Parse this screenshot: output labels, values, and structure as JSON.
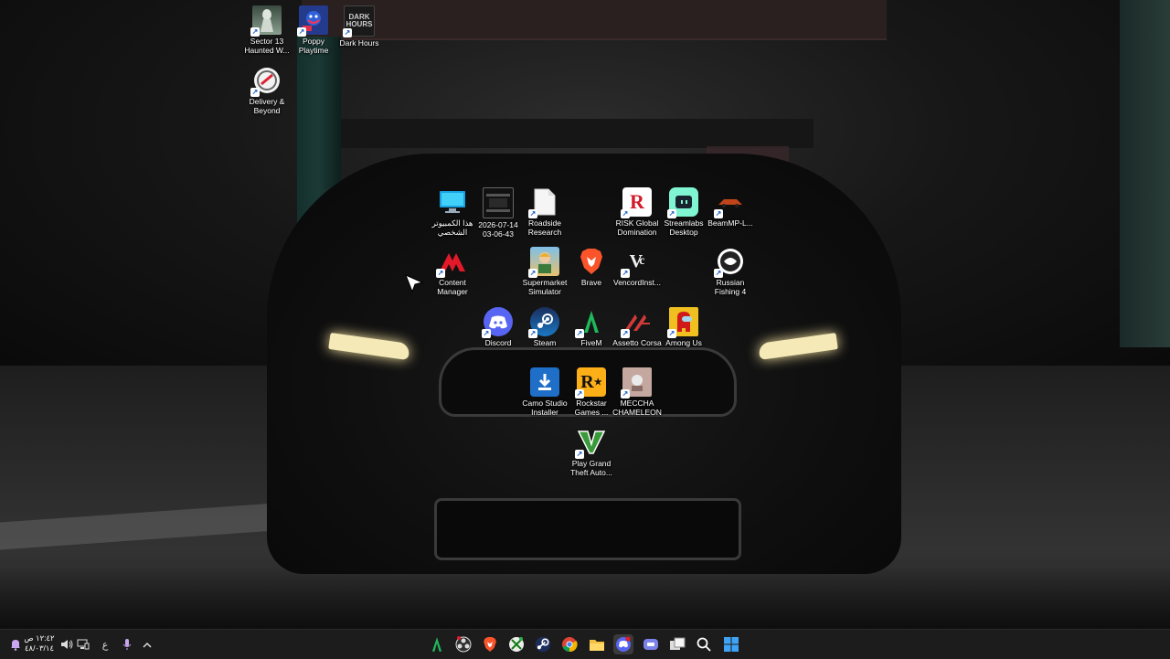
{
  "desktop_icons": [
    {
      "key": "sector13",
      "label": "Sector 13\nHaunted W...",
      "icon": "sector13-icon"
    },
    {
      "key": "poppy",
      "label": "Poppy\nPlaytime",
      "icon": "poppy-playtime-icon"
    },
    {
      "key": "darkhours",
      "label": "Dark Hours",
      "icon": "dark-hours-icon"
    },
    {
      "key": "delivery",
      "label": "Delivery &\nBeyond",
      "icon": "delivery-beyond-icon"
    },
    {
      "key": "thispc",
      "label": "هذا الكمبيوتر\nالشخصي",
      "icon": "this-pc-icon"
    },
    {
      "key": "screenshot",
      "label": "2026-07-14\n03-06-43",
      "icon": "video-file-icon"
    },
    {
      "key": "roadside",
      "label": "Roadside\nResearch",
      "icon": "blank-file-icon"
    },
    {
      "key": "risk",
      "label": "RISK Global\nDomination",
      "icon": "risk-icon"
    },
    {
      "key": "streamlabs",
      "label": "Streamlabs\nDesktop",
      "icon": "streamlabs-icon"
    },
    {
      "key": "beammp",
      "label": "BeamMP-L...",
      "icon": "beammp-icon"
    },
    {
      "key": "contentmanager",
      "label": "Content\nManager",
      "icon": "content-manager-icon"
    },
    {
      "key": "supermarket",
      "label": "Supermarket\nSimulator",
      "icon": "supermarket-simulator-icon"
    },
    {
      "key": "brave",
      "label": "Brave",
      "icon": "brave-icon"
    },
    {
      "key": "vencord",
      "label": "VencordInst...",
      "icon": "vencord-icon"
    },
    {
      "key": "russianfishing",
      "label": "Russian\nFishing 4",
      "icon": "russian-fishing-icon"
    },
    {
      "key": "discord",
      "label": "Discord",
      "icon": "discord-icon"
    },
    {
      "key": "steam",
      "label": "Steam",
      "icon": "steam-icon"
    },
    {
      "key": "fivem",
      "label": "FiveM",
      "icon": "fivem-icon"
    },
    {
      "key": "assetto",
      "label": "Assetto Corsa",
      "icon": "assetto-corsa-icon"
    },
    {
      "key": "amongus",
      "label": "Among Us",
      "icon": "among-us-icon"
    },
    {
      "key": "camo",
      "label": "Camo Studio\nInstaller",
      "icon": "camo-installer-icon"
    },
    {
      "key": "rockstar",
      "label": "Rockstar\nGames ...",
      "icon": "rockstar-launcher-icon"
    },
    {
      "key": "meccha",
      "label": "MECCHA\nCHAMELEON",
      "icon": "meccha-chameleon-icon"
    },
    {
      "key": "gta",
      "label": "Play Grand\nTheft Auto...",
      "icon": "gta-v-icon"
    }
  ],
  "taskbar": {
    "clock_time": "١٢:٤٢ ص",
    "clock_date": "٤٨/٠٣/١٤",
    "language": "ع",
    "apps": [
      {
        "key": "fivem",
        "icon": "fivem-icon"
      },
      {
        "key": "obs",
        "icon": "obs-icon"
      },
      {
        "key": "brave",
        "icon": "brave-icon"
      },
      {
        "key": "xbox",
        "icon": "xbox-icon"
      },
      {
        "key": "steam",
        "icon": "steam-icon"
      },
      {
        "key": "chrome",
        "icon": "chrome-icon"
      },
      {
        "key": "explorer",
        "icon": "file-explorer-icon"
      },
      {
        "key": "discord",
        "icon": "discord-icon"
      },
      {
        "key": "teams",
        "icon": "teams-icon"
      },
      {
        "key": "taskview",
        "icon": "task-view-icon"
      },
      {
        "key": "search",
        "icon": "search-icon"
      },
      {
        "key": "start",
        "icon": "windows-start-icon"
      }
    ]
  }
}
